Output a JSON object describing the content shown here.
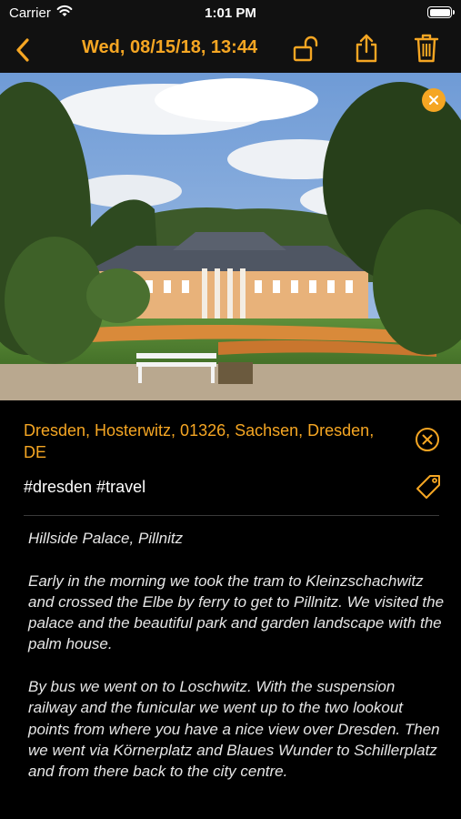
{
  "status_bar": {
    "carrier": "Carrier",
    "time": "1:01 PM"
  },
  "nav": {
    "title": "Wed, 08/15/18, 13:44",
    "accent_color": "#f5a623",
    "icons": [
      "chevron-left-icon",
      "unlock-icon",
      "share-icon",
      "trash-icon"
    ]
  },
  "entry": {
    "location": "Dresden, Hosterwitz, 01326, Sachsen, Dresden, DE",
    "tags": "#dresden #travel",
    "note_paragraphs": [
      "Hillside Palace, Pillnitz",
      "Early in the morning we took the tram to Kleinzschachwitz and crossed the Elbe by ferry to get to Pillnitz. We visited the palace and the beautiful park and garden landscape with the palm house.",
      "By bus we went on to Loschwitz. With the suspension railway and the funicular we went up to the two lookout points from where you have a nice view over Dresden. Then we went via Körnerplatz and Blaues Wunder to Schillerplatz and from there back to the city centre."
    ]
  }
}
